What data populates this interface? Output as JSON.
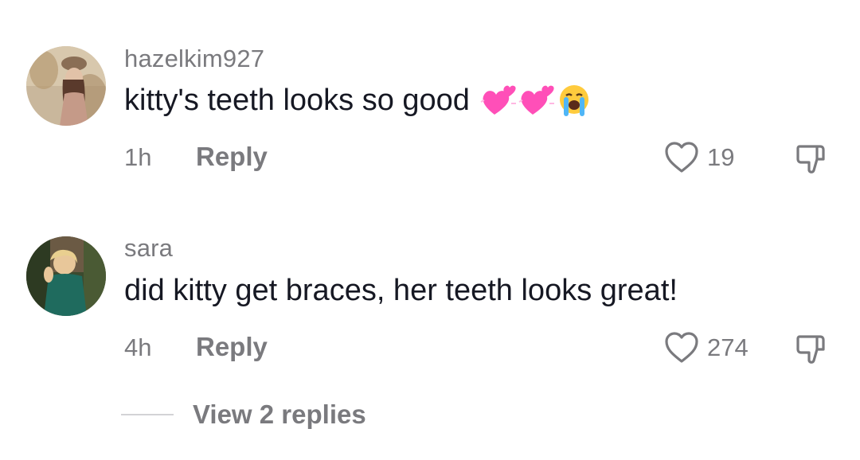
{
  "comments": [
    {
      "username": "hazelkim927",
      "text": "kitty's teeth looks so good",
      "emojis": [
        "two-hearts-emoji",
        "two-hearts-emoji",
        "loudly-crying-face-emoji"
      ],
      "time": "1h",
      "reply_label": "Reply",
      "like_count": "19"
    },
    {
      "username": "sara",
      "text": "did kitty get braces, her teeth looks great!",
      "time": "4h",
      "reply_label": "Reply",
      "like_count": "274"
    }
  ],
  "view_replies_label": "View 2 replies",
  "colors": {
    "secondary_text": "#7a7a7e",
    "primary_text": "#161823",
    "divider": "#d3d3d6",
    "emoji_pink": "#ff4fb8"
  }
}
